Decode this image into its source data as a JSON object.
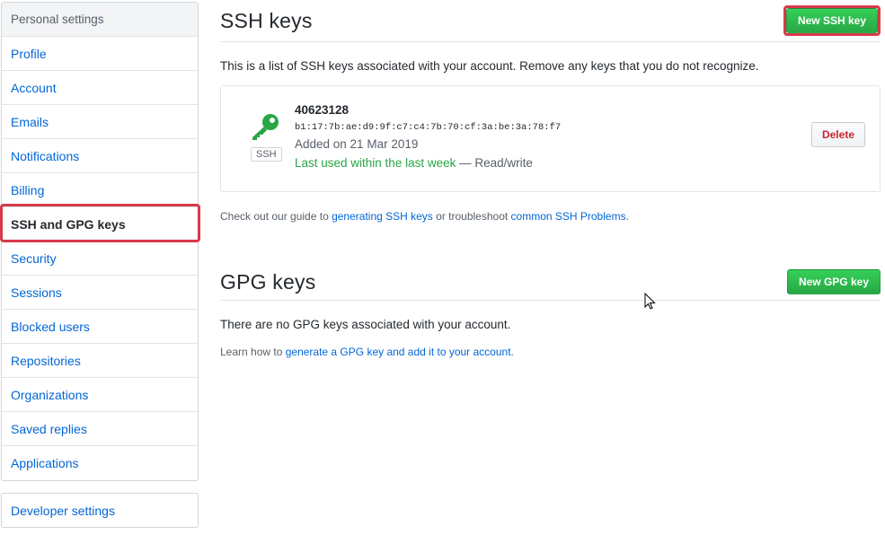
{
  "sidebar": {
    "header": "Personal settings",
    "items": [
      {
        "label": "Profile"
      },
      {
        "label": "Account"
      },
      {
        "label": "Emails"
      },
      {
        "label": "Notifications"
      },
      {
        "label": "Billing"
      },
      {
        "label": "SSH and GPG keys"
      },
      {
        "label": "Security"
      },
      {
        "label": "Sessions"
      },
      {
        "label": "Blocked users"
      },
      {
        "label": "Repositories"
      },
      {
        "label": "Organizations"
      },
      {
        "label": "Saved replies"
      },
      {
        "label": "Applications"
      }
    ],
    "selected": "SSH and GPG keys",
    "developer": "Developer settings"
  },
  "ssh": {
    "title": "SSH keys",
    "new_button": "New SSH key",
    "description": "This is a list of SSH keys associated with your account. Remove any keys that you do not recognize.",
    "key": {
      "title": "40623128",
      "fingerprint": "b1:17:7b:ae:d9:9f:c7:c4:7b:70:cf:3a:be:3a:78:f7",
      "added": "Added on 21 Mar 2019",
      "last_used": "Last used within the last week",
      "access": " — Read/write",
      "badge": "SSH",
      "delete_button": "Delete"
    },
    "note_prefix": "Check out our guide to ",
    "note_link1": "generating SSH keys",
    "note_middle": " or troubleshoot ",
    "note_link2": "common SSH Problems",
    "note_suffix": "."
  },
  "gpg": {
    "title": "GPG keys",
    "new_button": "New GPG key",
    "description": "There are no GPG keys associated with your account.",
    "note_prefix": "Learn how to ",
    "note_link": "generate a GPG key and add it to your account",
    "note_suffix": "."
  },
  "colors": {
    "link": "#0366d6",
    "green": "#28a745",
    "highlight": "#d73a49",
    "selected_bar": "#e36209"
  }
}
